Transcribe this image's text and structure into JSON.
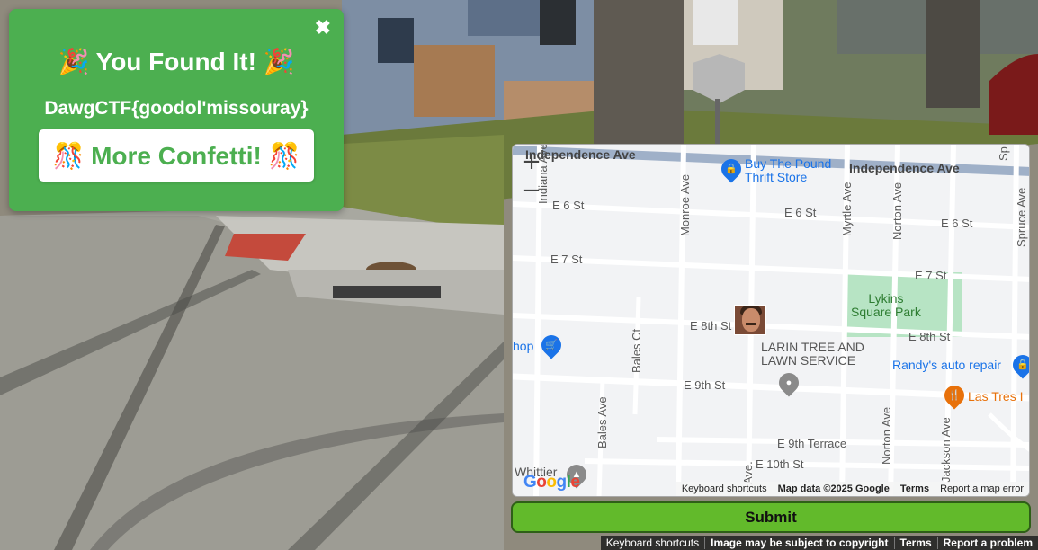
{
  "popup": {
    "close": "✖",
    "title": "🎉 You Found It! 🎉",
    "flag": "DawgCTF{goodol'missouray}",
    "confetti_button": "🎊 More Confetti! 🎊"
  },
  "map": {
    "zoom_in": "+",
    "zoom_out": "−",
    "streets": {
      "independence_ave_left": "Independence Ave",
      "independence_ave_right": "Independence Ave",
      "e6st_a": "E 6 St",
      "e6st_b": "E 6 St",
      "e6st_c": "E 6 St",
      "e7st_a": "E 7 St",
      "e7st_b": "E 7 St",
      "e8st_a": "E 8th St",
      "e8st_b": "E 8th St",
      "e9st": "E 9th St",
      "e9terr": "E 9th Terrace",
      "e10st": "E 10th St",
      "indiana": "Indiana Ave",
      "monroe": "Monroe Ave",
      "myrtle": "Myrtle Ave",
      "norton_top": "Norton Ave",
      "norton_bot": "Norton Ave",
      "spruce": "Spruce Ave",
      "bales_ct": "Bales Ct",
      "bales_ave": "Bales Ave",
      "jackson": "Jackson Ave",
      "sp": "Sp",
      "ave_frag": "Ave."
    },
    "pois": {
      "thrift": "Buy The Pound\nThrift Store",
      "park": "Lykins\nSquare Park",
      "larin": "LARIN TREE AND\nLAWN SERVICE",
      "randys": "Randy's auto repair",
      "las_tres": "Las Tres I",
      "shop": "hop",
      "whittier": "Whittier"
    },
    "google_logo": "Google",
    "attribution": {
      "shortcuts": "Keyboard shortcuts",
      "data": "Map data ©2025 Google",
      "terms": "Terms",
      "report": "Report a map error"
    }
  },
  "submit_label": "Submit",
  "footer": {
    "shortcuts": "Keyboard shortcuts",
    "copyright": "Image may be subject to copyright",
    "terms": "Terms",
    "report": "Report a problem"
  },
  "colors": {
    "popup_bg": "#4caf50",
    "submit_bg": "#62ba2b",
    "map_bg": "#f2f3f5",
    "park_green": "#b7e4c4"
  }
}
